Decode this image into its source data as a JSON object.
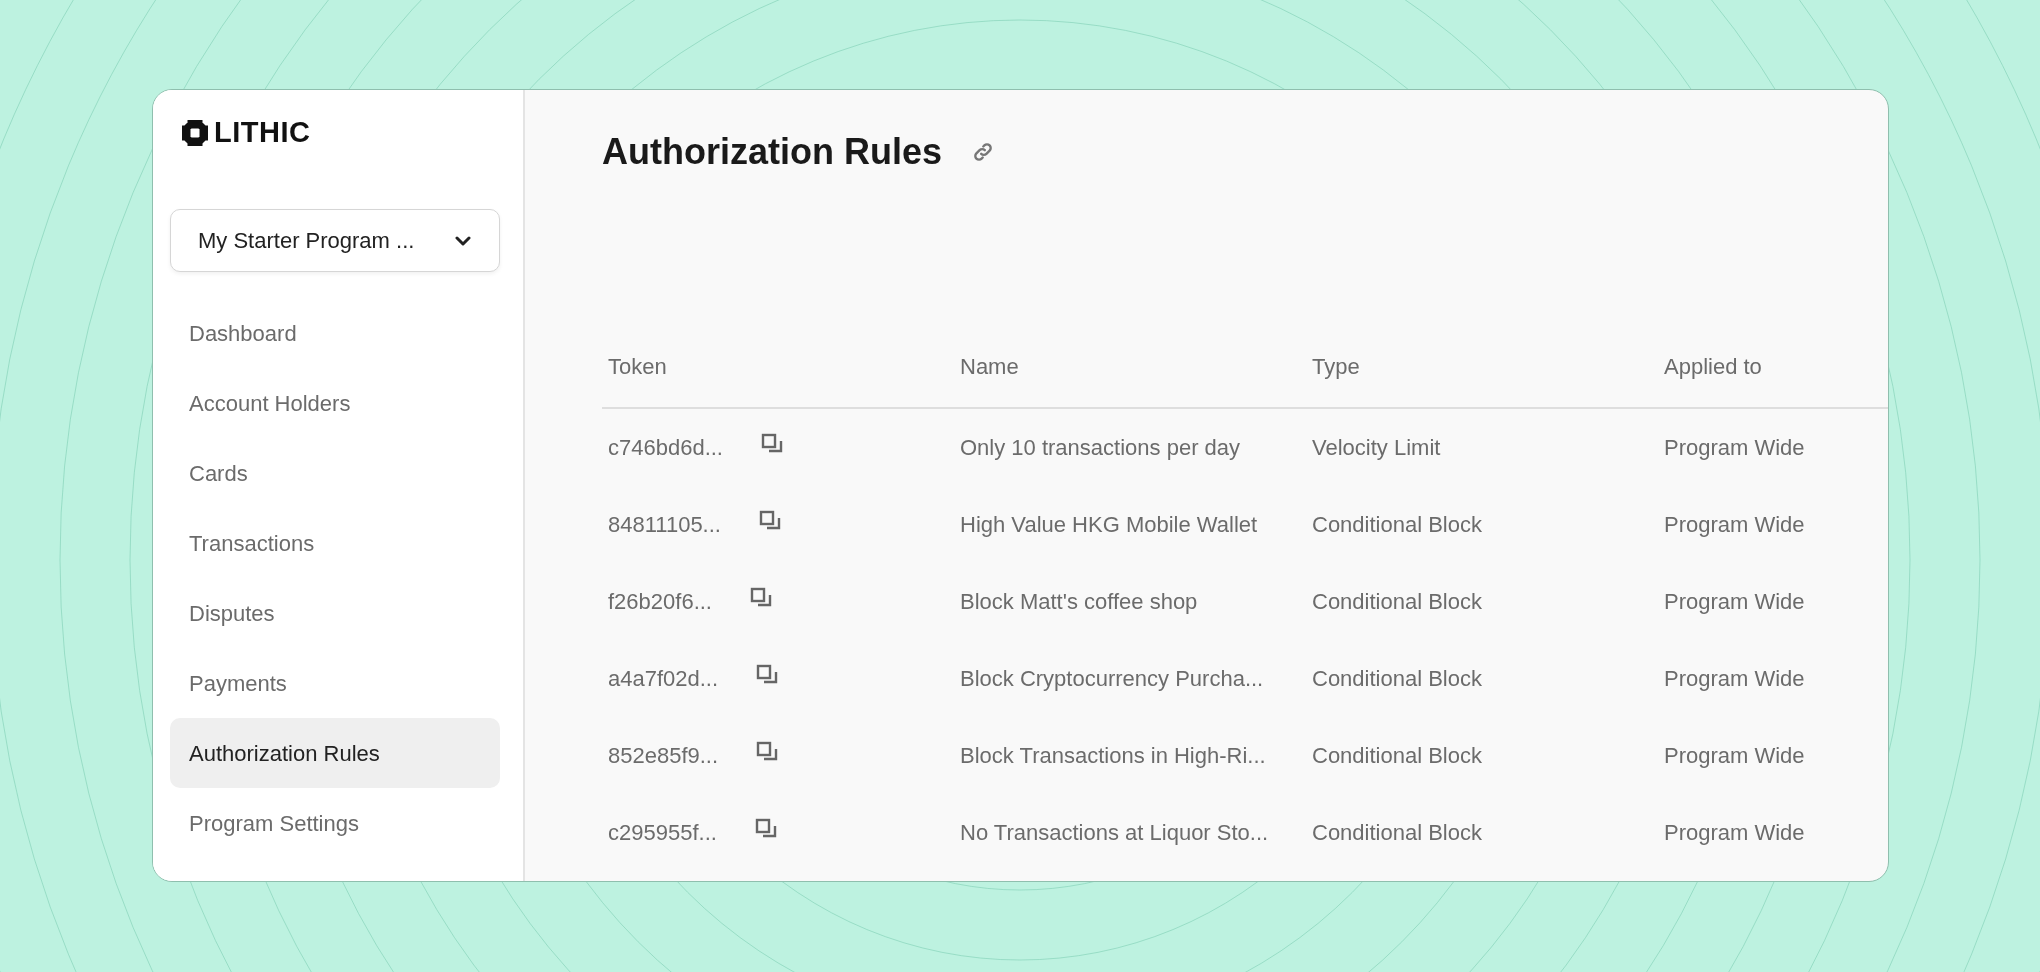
{
  "sidebar": {
    "logo": "LITHIC",
    "program_selector": {
      "value": "My Starter Program ..."
    },
    "items": [
      {
        "label": "Dashboard",
        "selected": false
      },
      {
        "label": "Account Holders",
        "selected": false
      },
      {
        "label": "Cards",
        "selected": false
      },
      {
        "label": "Transactions",
        "selected": false
      },
      {
        "label": "Disputes",
        "selected": false
      },
      {
        "label": "Payments",
        "selected": false
      },
      {
        "label": "Authorization Rules",
        "selected": true
      },
      {
        "label": "Program Settings",
        "selected": false
      }
    ]
  },
  "page": {
    "title": "Authorization Rules"
  },
  "table": {
    "columns": [
      "Token",
      "Name",
      "Type",
      "Applied to"
    ],
    "rows": [
      [
        "c746bd6d...",
        "Only 10 transactions per day",
        "Velocity Limit",
        "Program Wide"
      ],
      [
        "84811105...",
        "High Value HKG Mobile Wallet",
        "Conditional Block",
        "Program Wide"
      ],
      [
        "f26b20f6...",
        "Block Matt's coffee shop",
        "Conditional Block",
        "Program Wide"
      ],
      [
        "a4a7f02d...",
        "Block Cryptocurrency Purcha...",
        "Conditional Block",
        "Program Wide"
      ],
      [
        "852e85f9...",
        "Block Transactions in High-Ri...",
        "Conditional Block",
        "Program Wide"
      ],
      [
        "c295955f...",
        "No Transactions at Liquor Sto...",
        "Conditional Block",
        "Program Wide"
      ]
    ]
  }
}
